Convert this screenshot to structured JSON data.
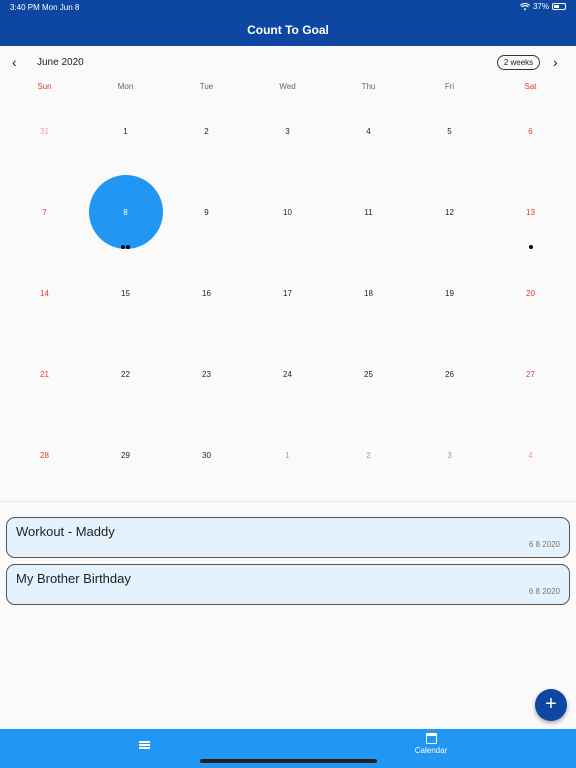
{
  "status_bar": {
    "time": "3:40 PM",
    "date": "Mon Jun 8",
    "battery": "37%"
  },
  "app_bar": {
    "title": "Count To Goal"
  },
  "calendar": {
    "month_label": "June 2020",
    "format_button": "2 weeks",
    "weekdays": [
      "Sun",
      "Mon",
      "Tue",
      "Wed",
      "Thu",
      "Fri",
      "Sat"
    ],
    "weeks": [
      [
        "31",
        "1",
        "2",
        "3",
        "4",
        "5",
        "6"
      ],
      [
        "7",
        "8",
        "9",
        "10",
        "11",
        "12",
        "13"
      ],
      [
        "14",
        "15",
        "16",
        "17",
        "18",
        "19",
        "20"
      ],
      [
        "21",
        "22",
        "23",
        "24",
        "25",
        "26",
        "27"
      ],
      [
        "28",
        "29",
        "30",
        "1",
        "2",
        "3",
        "4"
      ]
    ],
    "selected_day": "8",
    "colors": {
      "selected": "#2196f3",
      "weekend": "#e53935"
    }
  },
  "events": [
    {
      "title": "Workout - Maddy",
      "date": "6 8 2020"
    },
    {
      "title": "My Brother Birthday",
      "date": "6 8 2020"
    }
  ],
  "bottom_nav": {
    "calendar_label": "Calendar",
    "list_icon": "list-icon",
    "calendar_icon": "calendar-icon"
  },
  "fab": {
    "icon": "+"
  },
  "theme": {
    "primary_dark": "#0d47a1",
    "primary": "#2196f3",
    "event_bg": "#e3f2fd"
  }
}
